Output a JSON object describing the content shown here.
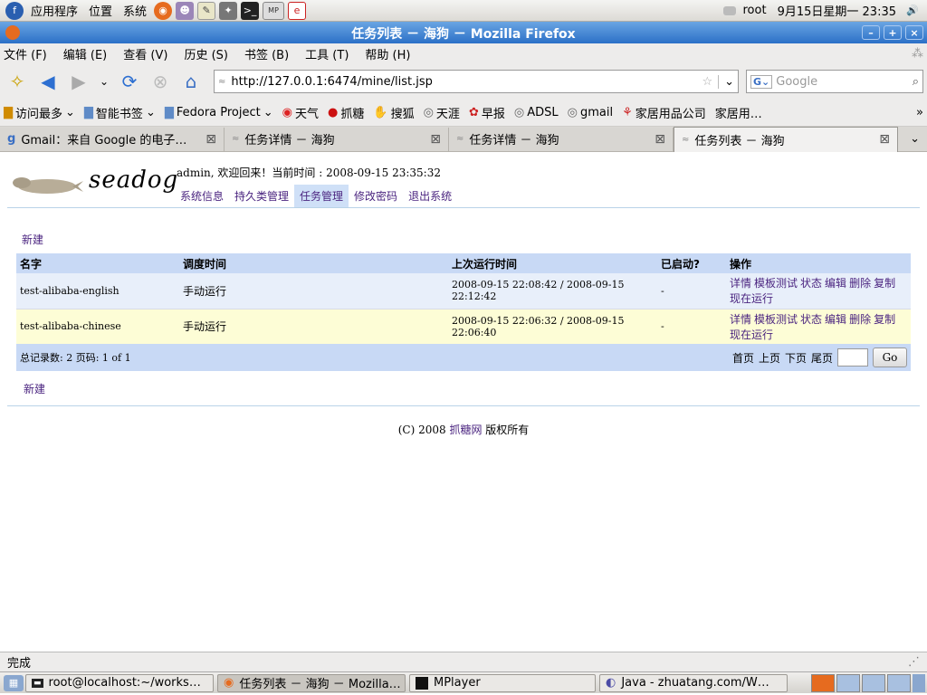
{
  "panel": {
    "apps": "应用程序",
    "places": "位置",
    "system": "系统",
    "user": "root",
    "clock": "9月15日星期一 23:35"
  },
  "window": {
    "title": "任务列表 － 海狗 － Mozilla Firefox"
  },
  "menu": [
    "文件 (F)",
    "编辑 (E)",
    "查看 (V)",
    "历史 (S)",
    "书签 (B)",
    "工具 (T)",
    "帮助 (H)"
  ],
  "nav": {
    "url": "http://127.0.0.1:6474/mine/list.jsp",
    "search_placeholder": "Google"
  },
  "bookmarks": [
    "访问最多",
    "智能书签",
    "Fedora Project",
    "天气",
    "抓糖",
    "搜狐",
    "天涯",
    "早报",
    "ADSL",
    "gmail",
    "家居用品公司",
    "家居用…"
  ],
  "tabs": [
    {
      "label": "Gmail：来自 Google 的电子…"
    },
    {
      "label": "任务详情 － 海狗"
    },
    {
      "label": "任务详情 － 海狗"
    },
    {
      "label": "任务列表 － 海狗"
    }
  ],
  "page": {
    "logo_text": "seadog",
    "welcome": "admin, 欢迎回来！当前时间 : 2008-09-15 23:35:32",
    "sysnav": [
      "系统信息",
      "持久类管理",
      "任务管理",
      "修改密码",
      "退出系统"
    ],
    "new_link": "新建",
    "table": {
      "headers": [
        "名字",
        "调度时间",
        "上次运行时间",
        "已启动?",
        "操作"
      ],
      "rows": [
        {
          "name": "test-alibaba-english",
          "schedule": "手动运行",
          "last_run": "2008-09-15 22:08:42 / 2008-09-15 22:12:42",
          "started": "-"
        },
        {
          "name": "test-alibaba-chinese",
          "schedule": "手动运行",
          "last_run": "2008-09-15 22:06:32 / 2008-09-15 22:06:40",
          "started": "-"
        }
      ],
      "ops": [
        "详情",
        "模板测试",
        "状态",
        "编辑",
        "删除",
        "复制",
        "现在运行"
      ]
    },
    "pager": {
      "summary": "总记录数: 2 页码: 1 of 1",
      "first": "首页",
      "prev": "上页",
      "next": "下页",
      "last": "尾页",
      "go": "Go"
    },
    "footer_pre": "(C) 2008 ",
    "footer_link": "抓糖网",
    "footer_post": " 版权所有"
  },
  "status": {
    "text": "完成"
  },
  "taskbar": [
    {
      "label": "root@localhost:~/works…"
    },
    {
      "label": "任务列表 － 海狗 － Mozilla…"
    },
    {
      "label": "MPlayer"
    },
    {
      "label": "Java - zhuatang.com/W…"
    }
  ]
}
